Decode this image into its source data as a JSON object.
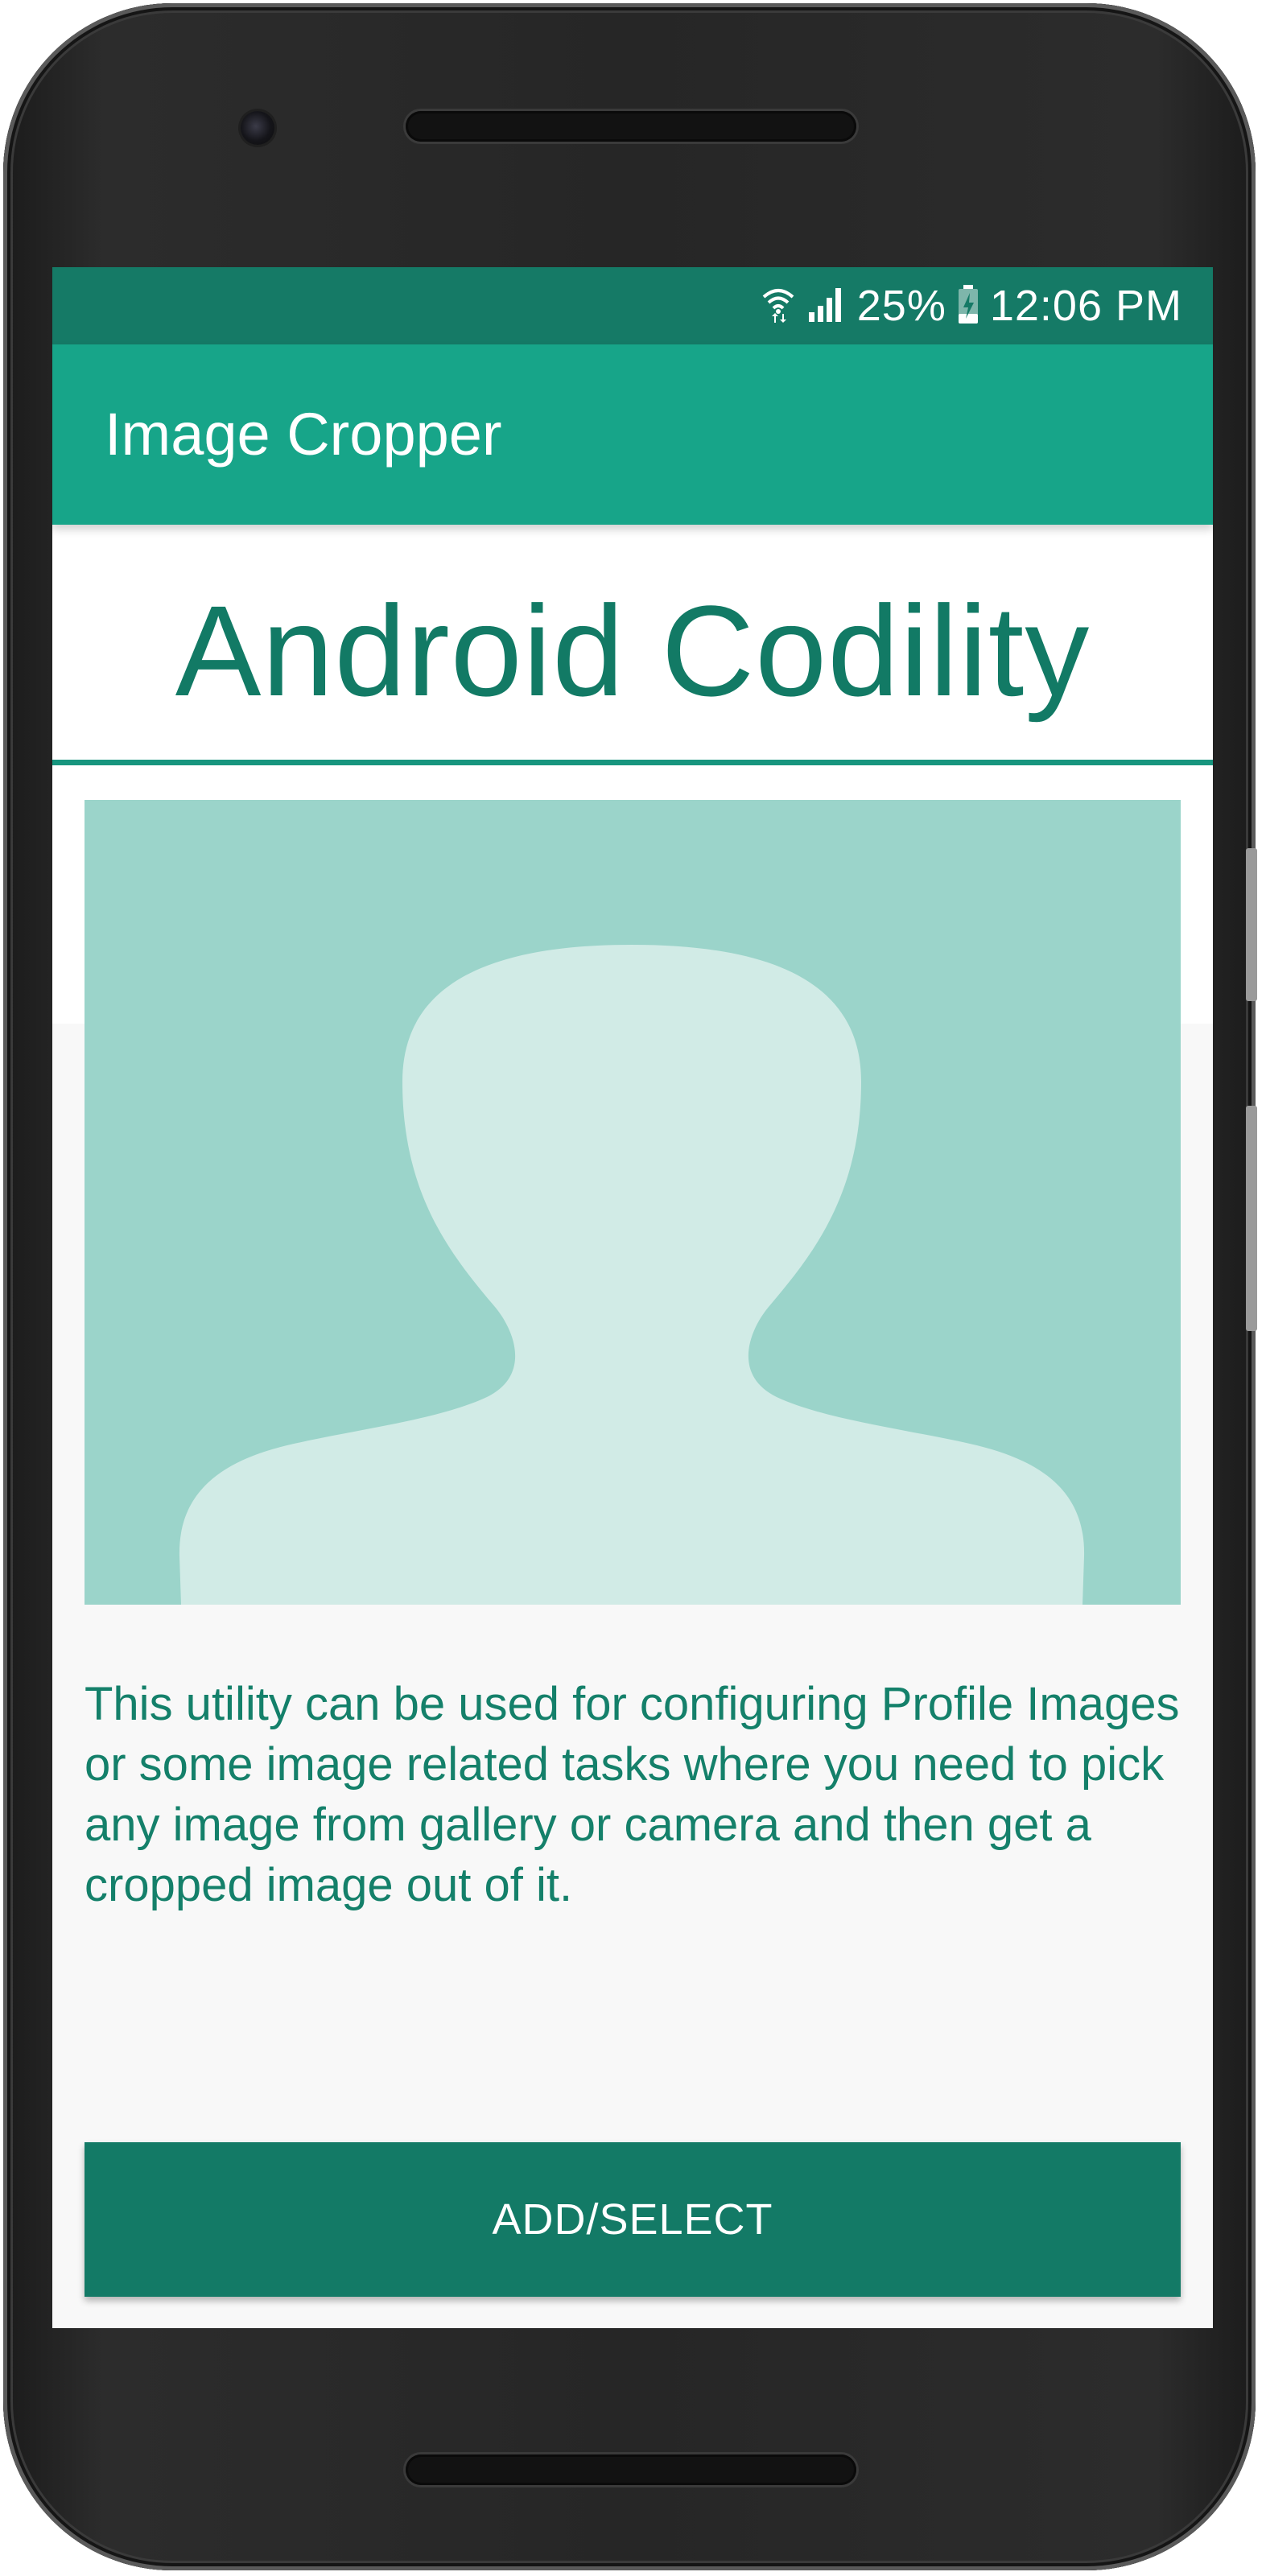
{
  "status_bar": {
    "battery": "25%",
    "time": "12:06 PM",
    "icons": [
      "wifi-icon",
      "signal-icon",
      "battery-charging-icon"
    ]
  },
  "app_bar": {
    "title": "Image Cropper"
  },
  "main": {
    "heading": "Android Codility",
    "image": {
      "icon": "profile-placeholder-icon"
    },
    "description": "This utility can be used for configuring Profile Images or some image related tasks where you need to pick any image from gallery or camera and then get a cropped image out of it.",
    "button_label": "ADD/SELECT"
  },
  "colors": {
    "status_bar": "#157a66",
    "app_bar": "#17a589",
    "accent": "#127a65",
    "image_background": "#9bd4ca",
    "silhouette": "#d1ebe6",
    "button": "#137a66"
  }
}
